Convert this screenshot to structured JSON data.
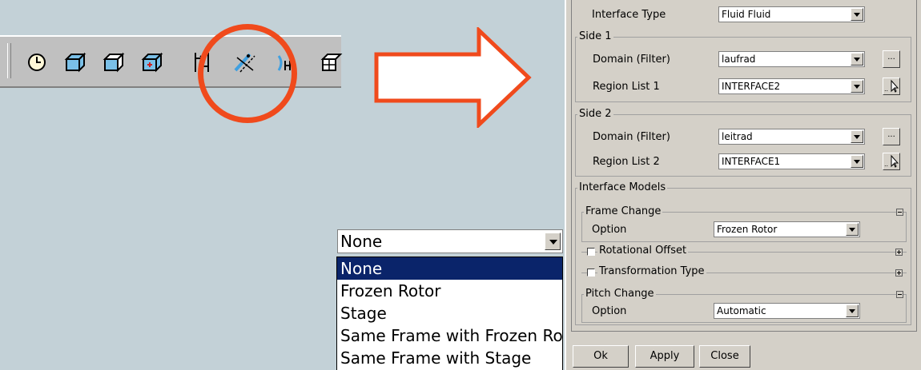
{
  "colors": {
    "highlight": "#f04a1c",
    "selection": "#0a246a",
    "panel_bg": "#d4d0c8",
    "canvas_bg": "#c3d1d7"
  },
  "toolbar": {
    "icons": [
      "clock-icon",
      "box-icon",
      "box-outline-icon",
      "box-plus-icon",
      "align-arrows-icon",
      "interface-icon",
      "rotation-icon",
      "grid-box-icon"
    ]
  },
  "dropdown": {
    "value": "None",
    "options": [
      "None",
      "Frozen Rotor",
      "Stage",
      "Same Frame with Frozen Rotor",
      "Same Frame with Stage"
    ]
  },
  "panel": {
    "interface_type_label": "Interface Type",
    "interface_type_value": "Fluid Fluid",
    "side1": {
      "title": "Side 1",
      "domain_label": "Domain (Filter)",
      "domain_value": "laufrad",
      "region_label": "Region List 1",
      "region_value": "INTERFACE2"
    },
    "side2": {
      "title": "Side 2",
      "domain_label": "Domain (Filter)",
      "domain_value": "leitrad",
      "region_label": "Region List 2",
      "region_value": "INTERFACE1"
    },
    "interface_models_title": "Interface Models",
    "frame_change": {
      "title": "Frame Change",
      "option_label": "Option",
      "option_value": "Frozen Rotor",
      "rotational_offset": "Rotational Offset",
      "transformation_type": "Transformation Type"
    },
    "pitch_change": {
      "title": "Pitch Change",
      "option_label": "Option",
      "option_value": "Automatic"
    },
    "browse_label": "...",
    "buttons": {
      "ok": "Ok",
      "apply": "Apply",
      "close": "Close"
    }
  }
}
